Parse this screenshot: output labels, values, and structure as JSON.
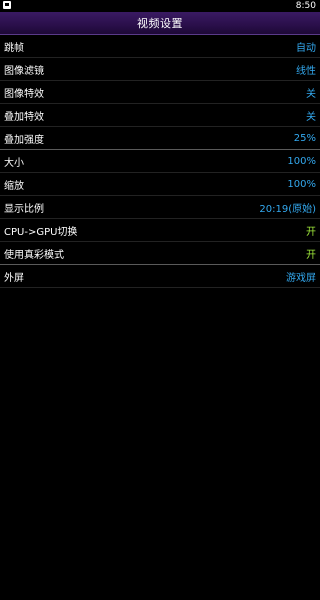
{
  "status": {
    "time": "8:50",
    "left_icon": "notification-icon"
  },
  "header": {
    "title": "视频设置"
  },
  "colors": {
    "header_bg": "#2a0f4a",
    "value_blue": "#33a8ee",
    "value_green": "#9ee63a"
  },
  "settings": [
    {
      "label": "跳帧",
      "value": "自动"
    },
    {
      "label": "图像滤镜",
      "value": "线性"
    },
    {
      "label": "图像特效",
      "value": "关"
    },
    {
      "label": "叠加特效",
      "value": "关"
    },
    {
      "label": "叠加强度",
      "value": "25%"
    },
    {
      "label": "大小",
      "value": "100%"
    },
    {
      "label": "缩放",
      "value": "100%"
    },
    {
      "label": "显示比例",
      "value": "20:19(原始)"
    },
    {
      "label": "CPU->GPU切换",
      "value": "开"
    },
    {
      "label": "使用真彩模式",
      "value": "开"
    },
    {
      "label": "外屏",
      "value": "游戏屏"
    }
  ]
}
